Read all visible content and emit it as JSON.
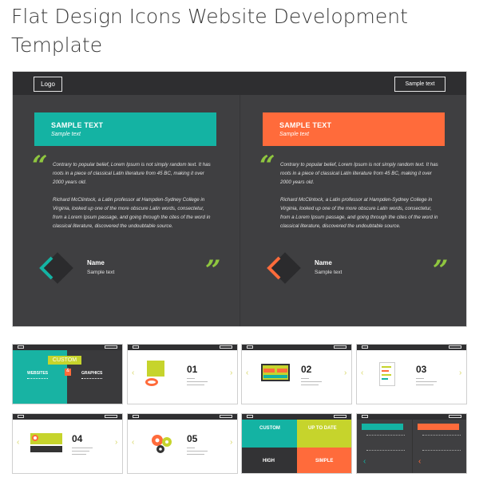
{
  "page": {
    "title": "Flat Design Icons Website Development Template"
  },
  "hero": {
    "logo_label": "Logo",
    "button_label": "Sample text",
    "cards": [
      {
        "accent": "#14b3a3",
        "banner_title": "SAMPLE TEXT",
        "banner_subtitle": "Sample text",
        "paragraph_1": "Contrary to popular belief, Lorem Ipsum is not simply random text. It has roots in a piece of classical Latin literature from 45 BC, making it over 2000 years old.",
        "paragraph_2": "Richard McClintock, a Latin professor at Hampden-Sydney College in Virginia, looked up one of the more obscure Latin words, consectetur, from a Lorem Ipsum passage, and going through the cites of the word in classical literature, discovered the undoubtable source.",
        "open_quote": "“",
        "close_quote": "”",
        "name": "Name",
        "name_sub": "Sample text"
      },
      {
        "accent": "#ff6b3b",
        "banner_title": "SAMPLE TEXT",
        "banner_subtitle": "Sample text",
        "paragraph_1": "Contrary to popular belief, Lorem Ipsum is not simply random text. It has roots in a piece of classical Latin literature from 45 BC, making it over 2000 years old.",
        "paragraph_2": "Richard McClintock, a Latin professor at Hampden-Sydney College in Virginia, looked up one of the more obscure Latin words, consectetur, from a Lorem Ipsum passage, and going through the cites of the word in classical literature, discovered the undoubtable source.",
        "open_quote": "“",
        "close_quote": "”",
        "name": "Name",
        "name_sub": "Sample text"
      }
    ],
    "quote_mark_color": "#8fc63f"
  },
  "thumbnails": {
    "slide1": {
      "custom": "CUSTOM",
      "websites": "WEBSITES",
      "amp": "&",
      "graphics": "GRAPHICS"
    },
    "slide2": {
      "num": "01"
    },
    "slide3": {
      "num": "02"
    },
    "slide4": {
      "num": "03"
    },
    "slide5": {
      "num": "04"
    },
    "slide6": {
      "num": "05"
    },
    "slide7": {
      "q1": "CUSTOM",
      "q2": "UP TO DATE",
      "q3": "HIGH",
      "q4": "SIMPLE"
    }
  },
  "colors": {
    "teal": "#14b3a3",
    "orange": "#ff6b3b",
    "lime": "#c6d42c",
    "dark": "#3f3f41"
  }
}
